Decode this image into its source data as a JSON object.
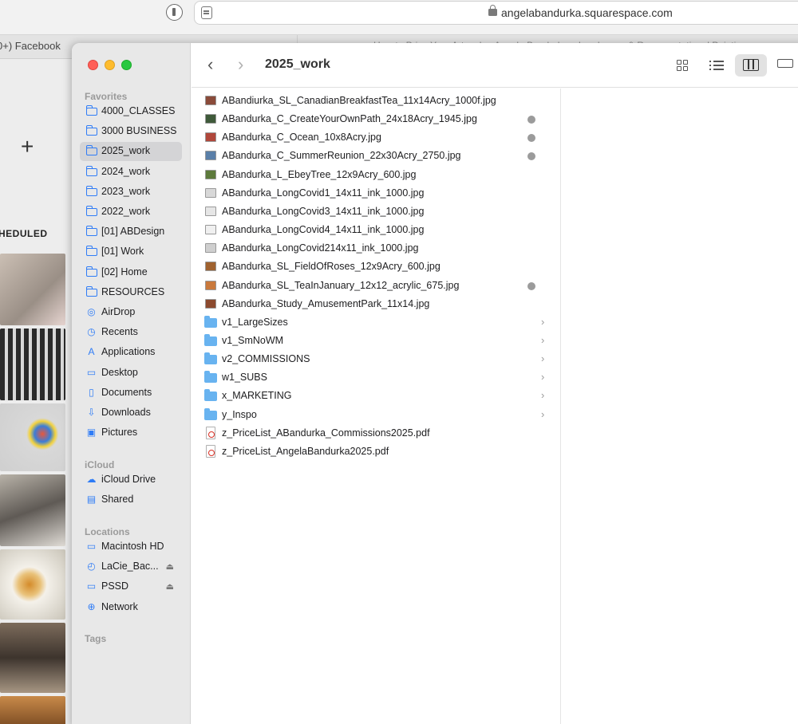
{
  "browser": {
    "url": "angelabandurka.squarespace.com",
    "left_tab_label": "0+) Facebook",
    "right_tab_label": "How to Price Your Artwork – Angela Bandurka – Landscape & Representational Painting"
  },
  "background_page": {
    "plus": "+",
    "scheduled_label": "HEDULED"
  },
  "window": {
    "title": "2025_work",
    "nav_back": "‹",
    "nav_forward": "›"
  },
  "sidebar": {
    "favorites_title": "Favorites",
    "favorites": [
      {
        "label": "4000_CLASSES",
        "icon": "folder-icon"
      },
      {
        "label": "3000 BUSINESS",
        "icon": "folder-icon"
      },
      {
        "label": "2025_work",
        "icon": "folder-icon",
        "selected": true
      },
      {
        "label": "2024_work",
        "icon": "folder-icon"
      },
      {
        "label": "2023_work",
        "icon": "folder-icon"
      },
      {
        "label": "2022_work",
        "icon": "folder-icon"
      },
      {
        "label": "[01] ABDesign",
        "icon": "folder-icon"
      },
      {
        "label": "[01] Work",
        "icon": "folder-icon"
      },
      {
        "label": "[02] Home",
        "icon": "folder-icon"
      },
      {
        "label": "RESOURCES",
        "icon": "folder-icon"
      },
      {
        "label": "AirDrop",
        "icon": "airdrop-icon"
      },
      {
        "label": "Recents",
        "icon": "clock-icon"
      },
      {
        "label": "Applications",
        "icon": "applications-icon"
      },
      {
        "label": "Desktop",
        "icon": "desktop-icon"
      },
      {
        "label": "Documents",
        "icon": "document-icon"
      },
      {
        "label": "Downloads",
        "icon": "download-icon"
      },
      {
        "label": "Pictures",
        "icon": "pictures-icon"
      }
    ],
    "icloud_title": "iCloud",
    "icloud": [
      {
        "label": "iCloud Drive",
        "icon": "cloud-icon"
      },
      {
        "label": "Shared",
        "icon": "shared-folder-icon"
      }
    ],
    "locations_title": "Locations",
    "locations": [
      {
        "label": "Macintosh HD",
        "icon": "disk-icon",
        "eject": false
      },
      {
        "label": "LaCie_Bac...",
        "icon": "time-machine-icon",
        "eject": true
      },
      {
        "label": "PSSD",
        "icon": "disk-icon",
        "eject": true
      },
      {
        "label": "Network",
        "icon": "globe-icon",
        "eject": false
      }
    ],
    "tags_title": "Tags"
  },
  "files": [
    {
      "name": "ABandiurka_SL_CanadianBreakfastTea_11x14Acry_1000f.jpg",
      "type": "image",
      "tag": false,
      "thumb_color": "#8a4b3a"
    },
    {
      "name": "ABandurka_C_CreateYourOwnPath_24x18Acry_1945.jpg",
      "type": "image",
      "tag": true,
      "thumb_color": "#3f5a3a"
    },
    {
      "name": "ABandurka_C_Ocean_10x8Acry.jpg",
      "type": "image",
      "tag": true,
      "thumb_color": "#b0473b"
    },
    {
      "name": "ABandurka_C_SummerReunion_22x30Acry_2750.jpg",
      "type": "image",
      "tag": true,
      "thumb_color": "#5a7fa8"
    },
    {
      "name": "ABandurka_L_EbeyTree_12x9Acry_600.jpg",
      "type": "image",
      "tag": false,
      "thumb_color": "#5d7a3c"
    },
    {
      "name": "ABandurka_LongCovid1_14x11_ink_1000.jpg",
      "type": "image",
      "tag": false,
      "thumb_color": "#d8d8d8"
    },
    {
      "name": "ABandurka_LongCovid3_14x11_ink_1000.jpg",
      "type": "image",
      "tag": false,
      "thumb_color": "#e6e6e6"
    },
    {
      "name": "ABandurka_LongCovid4_14x11_ink_1000.jpg",
      "type": "image",
      "tag": false,
      "thumb_color": "#f0f0f0"
    },
    {
      "name": "ABandurka_LongCovid214x11_ink_1000.jpg",
      "type": "image",
      "tag": false,
      "thumb_color": "#cfcfcf"
    },
    {
      "name": "ABandurka_SL_FieldOfRoses_12x9Acry_600.jpg",
      "type": "image",
      "tag": false,
      "thumb_color": "#a0622f"
    },
    {
      "name": "ABandurka_SL_TeaInJanuary_12x12_acrylic_675.jpg",
      "type": "image",
      "tag": true,
      "thumb_color": "#c9793c"
    },
    {
      "name": "ABandurka_Study_AmusementPark_11x14.jpg",
      "type": "image",
      "tag": false,
      "thumb_color": "#8c4a2e"
    },
    {
      "name": "v1_LargeSizes",
      "type": "folder"
    },
    {
      "name": "v1_SmNoWM",
      "type": "folder"
    },
    {
      "name": "v2_COMMISSIONS",
      "type": "folder"
    },
    {
      "name": "w1_SUBS",
      "type": "folder"
    },
    {
      "name": "x_MARKETING",
      "type": "folder"
    },
    {
      "name": "y_Inspo",
      "type": "folder"
    },
    {
      "name": "z_PriceList_ABandurka_Commissions2025.pdf",
      "type": "pdf"
    },
    {
      "name": "z_PriceList_AngelaBandurka2025.pdf",
      "type": "pdf"
    }
  ],
  "colors": {
    "accent": "#2f7cf6",
    "folder": "#68b3f0",
    "tag_gray": "#9b9b9b",
    "sidebar_bg": "#e8e8e8"
  }
}
